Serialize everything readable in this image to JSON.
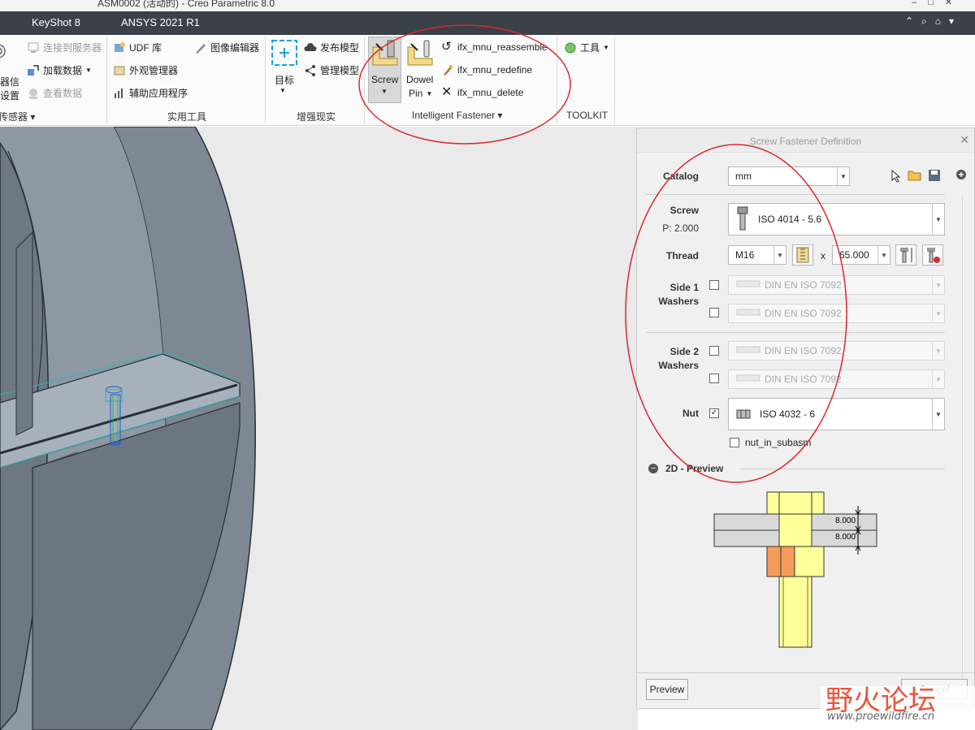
{
  "window": {
    "title": "ASM0002 (活动的) - Creo Parametric 8.0"
  },
  "tabs": [
    "KeyShot 8",
    "ANSYS 2021 R1"
  ],
  "ribbon": {
    "sensors": {
      "line1": "器信",
      "line2": "设置",
      "group": "传感器"
    },
    "server": {
      "connect": "连接到服务器",
      "load": "加载数据",
      "view": "查看数据"
    },
    "utilities": {
      "udf": "UDF 库",
      "appearance": "外观管理器",
      "aux_apps": "辅助应用程序",
      "image_editor": "图像编辑器",
      "group": "实用工具"
    },
    "ar": {
      "target": "目标",
      "publish": "发布模型",
      "manage": "管理模型",
      "group": "增强现实"
    },
    "fastener": {
      "screw": "Screw",
      "dowel": "Dowel",
      "pin": "Pin",
      "reassemble": "ifx_mnu_reassemble",
      "redefine": "ifx_mnu_redefine",
      "delete": "ifx_mnu_delete",
      "group": "Intelligent Fastener"
    },
    "toolkit": {
      "tools": "工具",
      "group": "TOOLKIT"
    }
  },
  "dialog": {
    "title": "Screw Fastener Definition",
    "catalog_label": "Catalog",
    "catalog_value": "mm",
    "screw_label": "Screw",
    "pitch": "P: 2.000",
    "screw_value": "ISO 4014 - 5.6",
    "thread_label": "Thread",
    "thread_size": "M16",
    "times": "x",
    "thread_length": "65.000",
    "side1_label_a": "Side 1",
    "side1_label_b": "Washers",
    "side2_label_a": "Side 2",
    "side2_label_b": "Washers",
    "washer_value": "DIN EN ISO 7092",
    "nut_label": "Nut",
    "nut_value": "ISO 4032 - 6",
    "nut_subasm": "nut_in_subasm",
    "preview_section": "2D - Preview",
    "dim1": "8.000",
    "dim2": "8.000",
    "preview_button": "Preview",
    "cancel_button": "Cancel"
  },
  "watermark": {
    "brand": "野火论坛",
    "url": "www.proewildfire.cn"
  },
  "colors": {
    "annotation": "#d9292b",
    "bolt_yellow": "#ffff99",
    "nut_orange": "#f59c5c",
    "model_gray": "#8a97a3"
  }
}
